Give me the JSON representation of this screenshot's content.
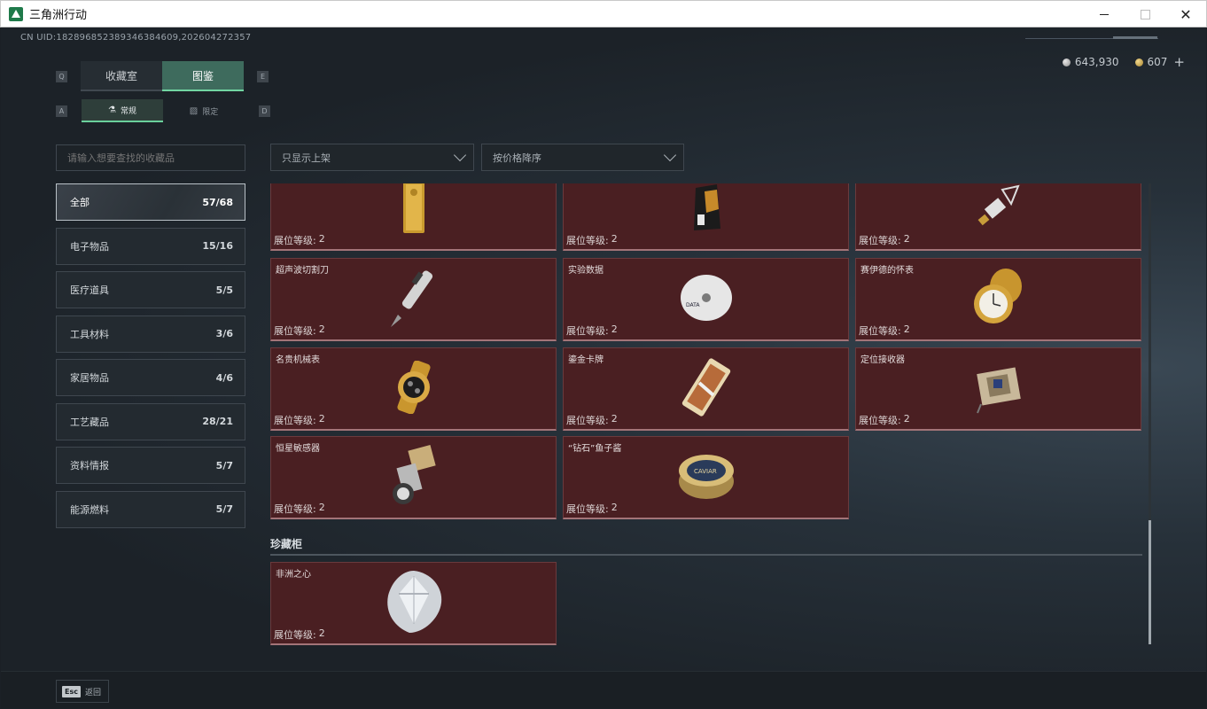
{
  "window": {
    "title": "三角洲行动"
  },
  "header": {
    "uid": "CN UID:1828968523893463846​09,2026​04272357",
    "currency": [
      {
        "icon": "silver-coin-icon",
        "value": "643,930"
      },
      {
        "icon": "gold-coin-icon",
        "value": "607"
      }
    ],
    "plus_label": "+"
  },
  "key_hints": {
    "tab_left": "Q",
    "tab_right": "E",
    "sub_left": "A",
    "sub_right": "D"
  },
  "tabs": [
    {
      "label": "收藏室",
      "active": false
    },
    {
      "label": "图鉴",
      "active": true
    }
  ],
  "subtabs": [
    {
      "label": "常规",
      "icon": "flask-icon",
      "active": true
    },
    {
      "label": "限定",
      "icon": "image-icon",
      "active": false
    }
  ],
  "search": {
    "placeholder": "请输入想要查找的收藏品"
  },
  "filters": {
    "availability": "只显示上架",
    "sort": "按价格降序"
  },
  "categories": [
    {
      "label": "全部",
      "count": "57/68",
      "active": true
    },
    {
      "label": "电子物品",
      "count": "15/16"
    },
    {
      "label": "医疗道具",
      "count": "5/5"
    },
    {
      "label": "工具材料",
      "count": "3/6"
    },
    {
      "label": "家居物品",
      "count": "4/6"
    },
    {
      "label": "工艺藏品",
      "count": "28/21"
    },
    {
      "label": "资料情报",
      "count": "5/7"
    },
    {
      "label": "能源燃料",
      "count": "5/7"
    }
  ],
  "level_label": "展位等级:",
  "items": [
    {
      "name": "",
      "level": "2",
      "icon": "gold-bar-icon"
    },
    {
      "name": "",
      "level": "2",
      "icon": "coffee-bag-icon"
    },
    {
      "name": "",
      "level": "2",
      "icon": "usb-drive-icon"
    },
    {
      "name": "超声波切割刀",
      "level": "2",
      "icon": "ultrasonic-cutter-icon"
    },
    {
      "name": "实验数据",
      "level": "2",
      "icon": "disc-icon"
    },
    {
      "name": "赛伊德的怀表",
      "level": "2",
      "icon": "pocket-watch-icon"
    },
    {
      "name": "名贵机械表",
      "level": "2",
      "icon": "wristwatch-icon"
    },
    {
      "name": "鎏金卡牌",
      "level": "2",
      "icon": "gilded-card-icon"
    },
    {
      "name": "定位接收器",
      "level": "2",
      "icon": "locator-receiver-icon"
    },
    {
      "name": "恒星敏感器",
      "level": "2",
      "icon": "star-sensor-icon"
    },
    {
      "name": "“钻石”鱼子酱",
      "level": "2",
      "icon": "caviar-tin-icon"
    }
  ],
  "treasure_section": {
    "title": "珍藏柜",
    "items": [
      {
        "name": "非洲之心",
        "level": "2",
        "icon": "diamond-icon"
      }
    ]
  },
  "footer": {
    "key": "Esc",
    "label": "返回"
  }
}
